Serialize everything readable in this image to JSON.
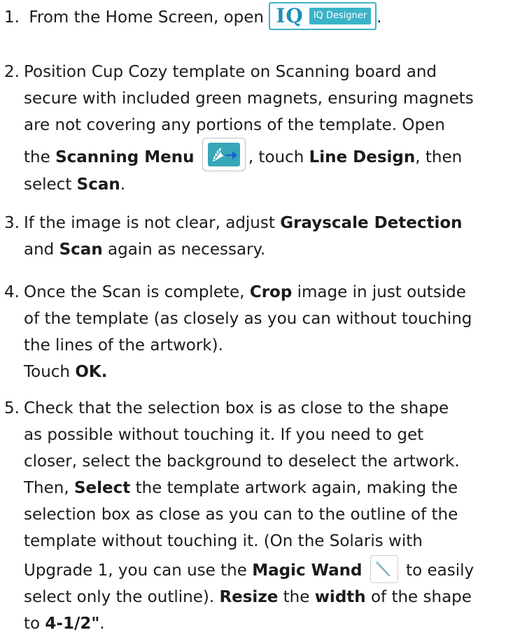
{
  "steps": [
    {
      "number": "1.",
      "text_before": "From the Home Screen, open",
      "icon_iq_mark": "IQ",
      "icon_iq_label": "IQ Designer",
      "text_after": "."
    },
    {
      "number": "2.",
      "line1": "Position Cup Cozy template on Scanning board and",
      "line2": "secure with included green magnets, ensuring magnets",
      "line3": "are not covering any portions of the template. Open",
      "line4_a": "the ",
      "line4_b": "Scanning Menu",
      "line4_c": ", touch ",
      "line4_d": "Line Design",
      "line4_e": ", then",
      "line5_a": "select ",
      "line5_b": "Scan",
      "line5_c": "."
    },
    {
      "number": "3.",
      "line1_a": "If the image is not clear, adjust ",
      "line1_b": "Grayscale Detection",
      "line2_a": "and ",
      "line2_b": "Scan",
      "line2_c": " again as necessary."
    },
    {
      "number": "4.",
      "line1_a": "Once the Scan is complete, ",
      "line1_b": "Crop",
      "line1_c": " image in just outside",
      "line2": "of the template (as closely as you can without touching",
      "line3": "the lines of the artwork).",
      "line4_a": "Touch ",
      "line4_b": "OK."
    },
    {
      "number": "5.",
      "line1": "Check that the selection box is as close to the shape",
      "line2": "as possible without touching it. If you need to get",
      "line3": "closer, select the background to deselect the artwork.",
      "line4_a": "Then, ",
      "line4_b": "Select",
      "line4_c": " the template artwork again, making the",
      "line5": "selection box as close as you can to the outline of the",
      "line6": "template without touching it. (On the Solaris with",
      "line7_a": "Upgrade 1, you can use the ",
      "line7_b": "Magic Wand",
      "line7_c": " to easily",
      "line8_a": "select only the outline). ",
      "line8_b": "Resize",
      "line8_c": " the ",
      "line8_d": "width",
      "line8_e": " of the shape",
      "line9_a": "to ",
      "line9_b": "4-1/2\"",
      "line9_c": "."
    }
  ],
  "colors": {
    "iq_blue": "#3bb3c7",
    "scan_teal": "#37a7b8"
  },
  "icons": [
    "iq-designer-icon",
    "scanning-menu-icon",
    "magic-wand-icon"
  ]
}
